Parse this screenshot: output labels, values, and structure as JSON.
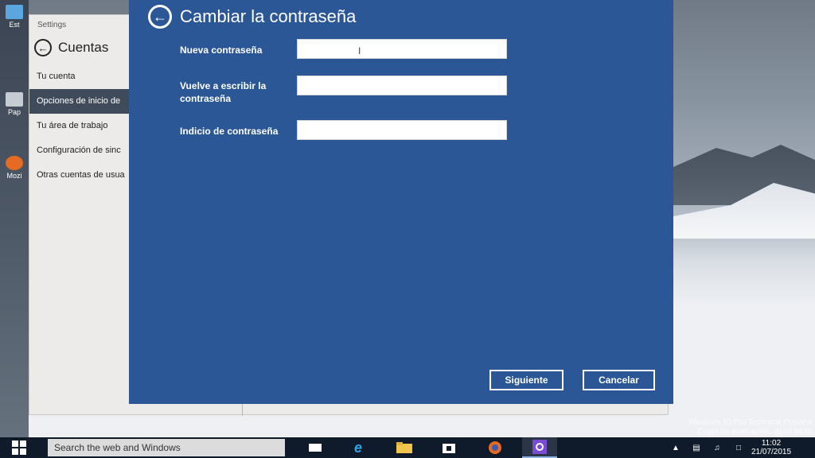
{
  "desktop": {
    "icons": [
      "Est",
      "Pap",
      "Mozi"
    ],
    "watermark_line1": "Windows 10 Pro Technical Preview",
    "watermark_line2": "Copia de evaluación. Build 9926"
  },
  "settings": {
    "window_title": "Settings",
    "section_title": "Cuentas",
    "nav_items": [
      {
        "label": "Tu cuenta"
      },
      {
        "label": "Opciones de inicio de"
      },
      {
        "label": "Tu área de trabajo"
      },
      {
        "label": "Configuración de sinc"
      },
      {
        "label": "Otras cuentas de usua"
      }
    ]
  },
  "dialog": {
    "title": "Cambiar la contraseña",
    "fields": [
      {
        "label": "Nueva contraseña",
        "value": ""
      },
      {
        "label": "Vuelve a escribir la contraseña",
        "value": ""
      },
      {
        "label": "Indicio de contraseña",
        "value": ""
      }
    ],
    "next_label": "Siguiente",
    "cancel_label": "Cancelar",
    "colors": {
      "background": "#2b5797",
      "text": "#ffffff"
    }
  },
  "taskbar": {
    "search_placeholder": "Search the web and Windows",
    "time": "11:02",
    "date": "21/07/2015",
    "apps": [
      "task-view",
      "internet-explorer",
      "file-explorer",
      "store",
      "firefox",
      "settings"
    ]
  }
}
